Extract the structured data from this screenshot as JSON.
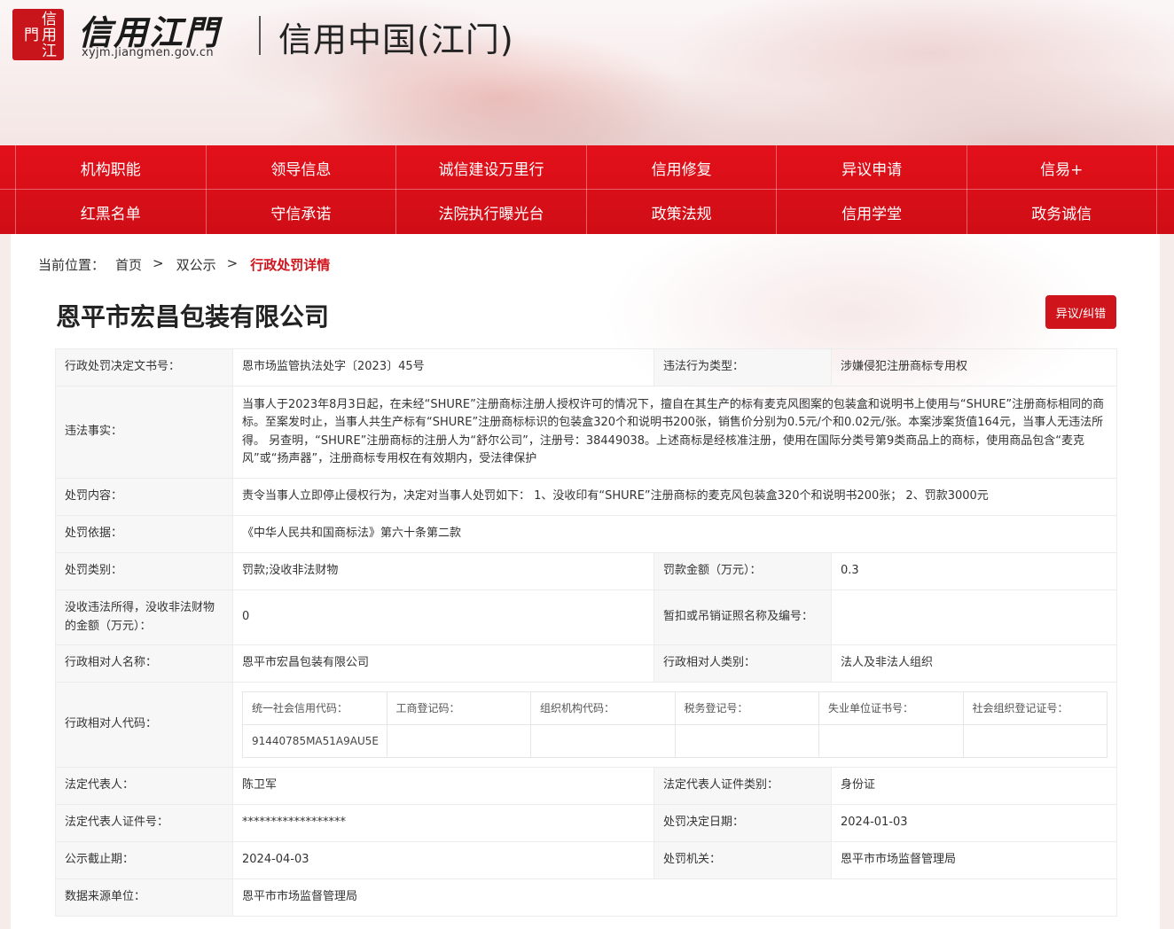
{
  "header": {
    "seal_text": "信用江門",
    "logo_text": "信用江門",
    "logo_url": "xyjm.jiangmen.gov.cn",
    "site_title": "信用中国(江门)"
  },
  "nav": {
    "row1": [
      "机构职能",
      "领导信息",
      "诚信建设万里行",
      "信用修复",
      "异议申请",
      "信易+"
    ],
    "row2": [
      "红黑名单",
      "守信承诺",
      "法院执行曝光台",
      "政策法规",
      "信用学堂",
      "政务诚信"
    ]
  },
  "breadcrumb": {
    "prefix": "当前位置：",
    "home": "首页",
    "sep": ">",
    "section": "双公示",
    "current": "行政处罚详情"
  },
  "company_name": "恩平市宏昌包装有限公司",
  "objection_button": "异议/纠错",
  "details": {
    "doc_no_label": "行政处罚决定文书号：",
    "doc_no": "恩市场监管执法处字〔2023〕45号",
    "violation_type_label": "违法行为类型：",
    "violation_type": "涉嫌侵犯注册商标专用权",
    "facts_label": "违法事实：",
    "facts": "当事人于2023年8月3日起，在未经“SHURE”注册商标注册人授权许可的情况下，擅自在其生产的标有麦克风图案的包装盒和说明书上使用与“SHURE”注册商标相同的商标。至案发时止，当事人共生产标有“SHURE”注册商标标识的包装盒320个和说明书200张，销售价分别为0.5元/个和0.02元/张。本案涉案货值164元，当事人无违法所得。 另查明，“SHURE”注册商标的注册人为“舒尔公司”，注册号：38449038。上述商标是经核准注册，使用在国际分类号第9类商品上的商标，使用商品包含“麦克风”或“扬声器”，注册商标专用权在有效期内，受法律保护",
    "content_label": "处罚内容：",
    "content": "责令当事人立即停止侵权行为，决定对当事人处罚如下： 1、没收印有“SHURE”注册商标的麦克风包装盒320个和说明书200张； 2、罚款3000元",
    "basis_label": "处罚依据：",
    "basis": "《中华人民共和国商标法》第六十条第二款",
    "category_label": "处罚类别：",
    "category": "罚款;没收非法财物",
    "fine_label": "罚款金额（万元）：",
    "fine": "0.3",
    "confiscated_label": "没收违法所得，没收非法财物的金额（万元）：",
    "confiscated": "0",
    "license_label": "暂扣或吊销证照名称及编号：",
    "license": "",
    "party_name_label": "行政相对人名称：",
    "party_name": "恩平市宏昌包装有限公司",
    "party_type_label": "行政相对人类别：",
    "party_type": "法人及非法人组织",
    "party_code_label": "行政相对人代码：",
    "code_headers": [
      "统一社会信用代码：",
      "工商登记码：",
      "组织机构代码：",
      "税务登记号：",
      "失业单位证书号：",
      "社会组织登记证号："
    ],
    "code_values": [
      "91440785MA51A9AU5E",
      "",
      "",
      "",
      "",
      ""
    ],
    "legal_rep_label": "法定代表人：",
    "legal_rep": "陈卫军",
    "legal_rep_id_type_label": "法定代表人证件类别：",
    "legal_rep_id_type": "身份证",
    "legal_rep_id_label": "法定代表人证件号：",
    "legal_rep_id": "******************",
    "decision_date_label": "处罚决定日期：",
    "decision_date": "2024-01-03",
    "publicity_deadline_label": "公示截止期：",
    "publicity_deadline": "2024-04-03",
    "authority_label": "处罚机关：",
    "authority": "恩平市市场监督管理局",
    "source_label": "数据来源单位：",
    "source": "恩平市市场监督管理局"
  }
}
